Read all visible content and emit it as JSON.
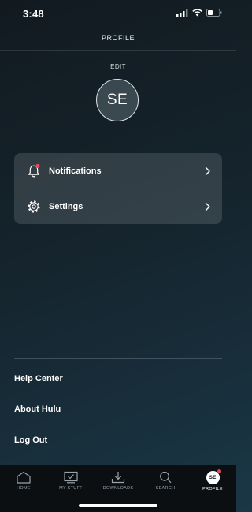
{
  "status_bar": {
    "time": "3:48"
  },
  "header": {
    "title": "PROFILE"
  },
  "profile": {
    "edit_label": "EDIT",
    "avatar_initials": "SE"
  },
  "menu": {
    "items": [
      {
        "label": "Notifications",
        "icon": "bell-icon",
        "has_badge": true
      },
      {
        "label": "Settings",
        "icon": "gear-icon"
      }
    ]
  },
  "links": [
    {
      "label": "Help Center"
    },
    {
      "label": "About Hulu"
    },
    {
      "label": "Log Out"
    }
  ],
  "tab_bar": {
    "tabs": [
      {
        "label": "HOME",
        "icon": "home-icon"
      },
      {
        "label": "MY STUFF",
        "icon": "my-stuff-icon"
      },
      {
        "label": "DOWNLOADS",
        "icon": "download-icon"
      },
      {
        "label": "SEARCH",
        "icon": "search-icon"
      },
      {
        "label": "PROFILE",
        "icon": "profile-avatar",
        "initials": "SE",
        "active": true
      }
    ]
  },
  "colors": {
    "badge": "#e04a5a",
    "tab_bar_bg": "#0b0f12"
  }
}
